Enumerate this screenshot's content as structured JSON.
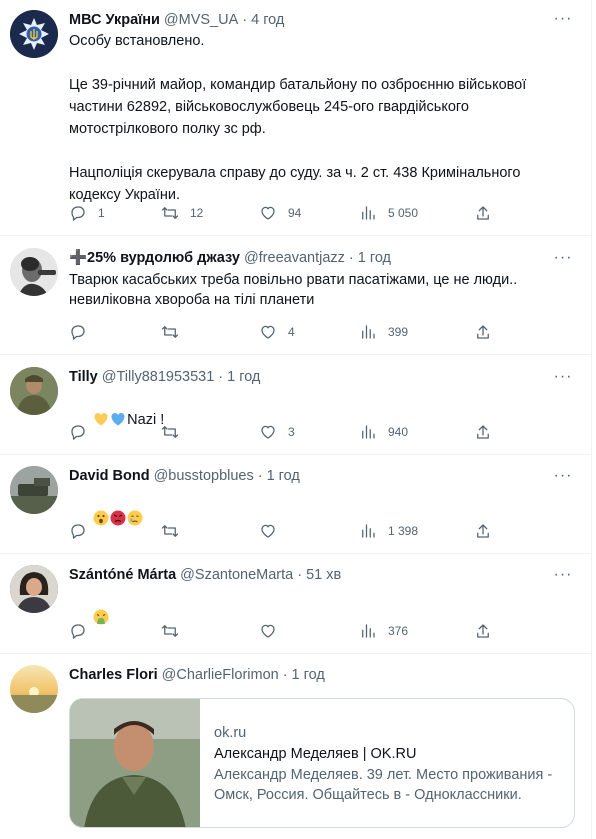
{
  "tweets": [
    {
      "name": "МВС України",
      "handle": "@MVS_UA",
      "time": "4 год",
      "text": "Особу встановлено.\n\nЦе 39-річний майор, командир батальйону по озброєнню військової частини 62892, військовослужбовець 245-ого гвардійського мотострілкового полку зс рф.\n\nНацполіція скерувала справу до суду. за ч. 2 ст. 438 Кримінального кодексу України.",
      "replies": "1",
      "retweets": "12",
      "likes": "94",
      "views": "5 050"
    },
    {
      "name": "➕25% вурдолюб джазу",
      "handle": "@freeavantjazz",
      "time": "1 год",
      "text": "Тварюк касабських треба повільно рвати пасатіжами, це не люди.. невиліковна хвороба на тілі планети",
      "replies": "",
      "retweets": "",
      "likes": "4",
      "views": "399"
    },
    {
      "name": "Tilly",
      "handle": "@Tilly881953531",
      "time": "1 год",
      "text": "Nazi !",
      "emojis": [
        "yellow-heart",
        "blue-heart"
      ],
      "replies": "",
      "retweets": "",
      "likes": "3",
      "views": "940"
    },
    {
      "name": "David Bond",
      "handle": "@busstopblues",
      "time": "1 год",
      "text": "",
      "emojis": [
        "astonished-face",
        "angry-face",
        "crying-face"
      ],
      "replies": "",
      "retweets": "",
      "likes": "",
      "views": "1 398"
    },
    {
      "name": "Szántóné Márta",
      "handle": "@SzantoneMarta",
      "time": "51 хв",
      "text": "",
      "emojis": [
        "vomiting-face"
      ],
      "replies": "",
      "retweets": "",
      "likes": "",
      "views": "376"
    },
    {
      "name": "Charles Flori",
      "handle": "@CharlieFlorimon",
      "time": "1 год",
      "card": {
        "domain": "ok.ru",
        "title": "Александр Меделяев | OK.RU",
        "description": "Александр Меделяев. 39 лет. Место проживания - Омск, Россия. Общайтесь в - Одноклассники."
      }
    }
  ],
  "sep": "·",
  "more": "···",
  "icons": {
    "reply": "reply-icon",
    "retweet": "retweet-icon",
    "like": "heart-icon",
    "views": "views-icon",
    "share": "share-icon"
  },
  "colors": {
    "text": "#0f1419",
    "secondary": "#536471",
    "border": "#eff3f4"
  }
}
